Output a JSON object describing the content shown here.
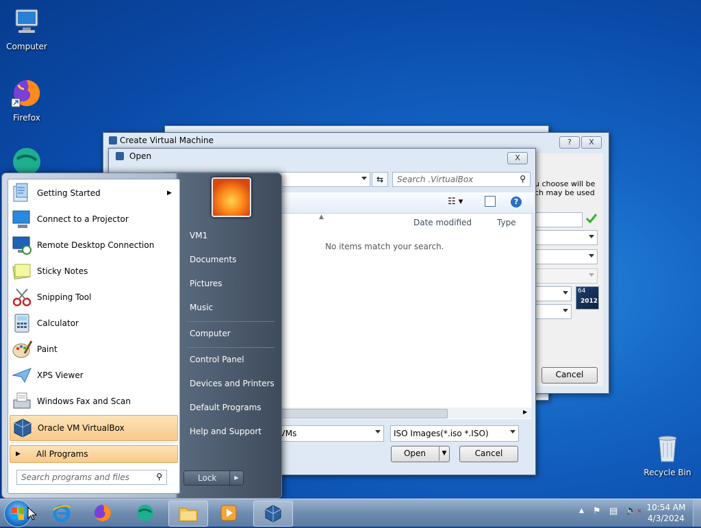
{
  "desktop": {
    "icons": [
      {
        "label": "Computer"
      },
      {
        "label": "Firefox"
      },
      {
        "label": "Recycle Bin"
      }
    ]
  },
  "create_vm": {
    "title": "Create Virtual Machine",
    "help_btn": "?",
    "close_btn": "X",
    "text_line1": "u choose will be",
    "text_line2": "ch may be used",
    "cancel": "Cancel",
    "os_badge_bits": "64",
    "os_badge_year": "2012"
  },
  "open_dialog": {
    "title": "Open",
    "close_btn": "X",
    "search_placeholder": "Search .VirtualBox",
    "col_date": "Date modified",
    "col_type": "Type",
    "empty_message": "No items match your search.",
    "filename_value": "t VMs",
    "filter_value": "ISO Images(*.iso *.ISO)",
    "open_btn": "Open",
    "cancel_btn": "Cancel"
  },
  "start_menu": {
    "programs": [
      {
        "label": "Getting Started",
        "icon": "getting-started-icon"
      },
      {
        "label": "Connect to a Projector",
        "icon": "projector-icon"
      },
      {
        "label": "Remote Desktop Connection",
        "icon": "remote-desktop-icon"
      },
      {
        "label": "Sticky Notes",
        "icon": "sticky-notes-icon"
      },
      {
        "label": "Snipping Tool",
        "icon": "snipping-tool-icon"
      },
      {
        "label": "Calculator",
        "icon": "calculator-icon"
      },
      {
        "label": "Paint",
        "icon": "paint-icon"
      },
      {
        "label": "XPS Viewer",
        "icon": "xps-viewer-icon"
      },
      {
        "label": "Windows Fax and Scan",
        "icon": "fax-scan-icon"
      },
      {
        "label": "Oracle VM VirtualBox",
        "icon": "virtualbox-icon"
      }
    ],
    "all_programs": "All Programs",
    "search_placeholder": "Search programs and files",
    "right_items": [
      "VM1",
      "Documents",
      "Pictures",
      "Music",
      "Computer",
      "Control Panel",
      "Devices and Printers",
      "Default Programs",
      "Help and Support"
    ],
    "lock": "Lock"
  },
  "taskbar": {
    "time": "10:54 AM",
    "date": "4/3/2024"
  }
}
